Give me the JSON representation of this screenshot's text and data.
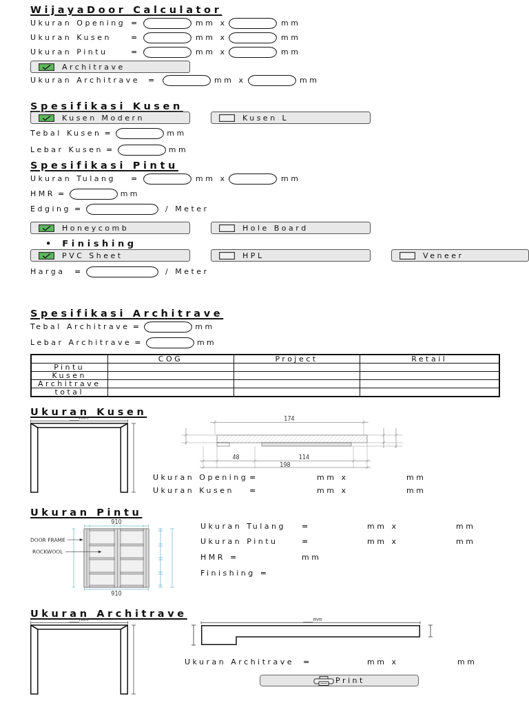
{
  "title": "WijayaDoor Calculator",
  "size_rows": [
    {
      "label": "Ukuran Opening",
      "sep": "=",
      "units": [
        "mm x",
        "mm"
      ]
    },
    {
      "label": "Ukuran Kusen",
      "sep": "=",
      "units": [
        "mm x",
        "mm"
      ]
    },
    {
      "label": "Ukuran Pintu",
      "sep": "=",
      "units": [
        "mm x",
        "mm"
      ]
    }
  ],
  "architrave_toggle": {
    "label": "Architrave",
    "checked": true
  },
  "architrave_row": {
    "label": "Ukuran Architrave",
    "sep": "=",
    "units": [
      "mm x",
      "mm"
    ]
  },
  "kusen_spec": {
    "heading": "Spesifikasi Kusen",
    "options": [
      {
        "label": "Kusen Modern",
        "checked": true
      },
      {
        "label": "Kusen L",
        "checked": false
      }
    ],
    "rows": [
      {
        "label": "Tebal Kusen",
        "sep": "=",
        "units": [
          "mm"
        ]
      },
      {
        "label": "Lebar Kusen",
        "sep": "=",
        "units": [
          "mm"
        ]
      }
    ]
  },
  "pintu_spec": {
    "heading": "Spesifikasi Pintu",
    "rows": [
      {
        "kind": "dimension",
        "label": "Ukuran Tulang",
        "sep": "=",
        "units": [
          "mm x",
          "mm"
        ]
      },
      {
        "kind": "single",
        "label": "HMR",
        "sep": "=",
        "units": [
          "mm"
        ]
      },
      {
        "kind": "rate",
        "label": "Edging",
        "sep": "=",
        "units": [
          "/ Meter"
        ]
      }
    ],
    "core_options": [
      {
        "label": "Honeycomb",
        "checked": true
      },
      {
        "label": "Hole Board",
        "checked": false
      }
    ],
    "finishing": {
      "bullet": "•",
      "heading": "Finishing",
      "options": [
        {
          "label": "PVC Sheet",
          "checked": true
        },
        {
          "label": "HPL",
          "checked": false
        },
        {
          "label": "Veneer",
          "checked": false
        }
      ]
    },
    "price_row": {
      "label": "Harga",
      "sep": "=",
      "units": [
        "/ Meter"
      ]
    }
  },
  "architrave_spec": {
    "heading": "Spesifikasi Architrave",
    "rows": [
      {
        "label": "Tebal Architrave",
        "sep": "=",
        "units": [
          "mm"
        ]
      },
      {
        "label": "Lebar Architrave",
        "sep": "=",
        "units": [
          "mm"
        ]
      }
    ]
  },
  "price_table": {
    "columns": [
      "COG",
      "Project",
      "Retail"
    ],
    "rows": [
      "Pintu",
      "Kusen",
      "Architrave",
      "total"
    ]
  },
  "kusen_section": {
    "heading": "Ukuran Kusen",
    "frame_width_label": "____mm",
    "profile_dimensions": [
      "174",
      "48",
      "114",
      "198"
    ],
    "rows": [
      {
        "label": "Ukuran Opening",
        "sep": "=",
        "units": [
          "mm x",
          "mm"
        ]
      },
      {
        "label": "Ukuran Kusen",
        "sep": "=",
        "units": [
          "mm x",
          "mm"
        ]
      }
    ]
  },
  "pintu_section": {
    "heading": "Ukuran Pintu",
    "door_width_labels": [
      "910",
      "910"
    ],
    "callouts": [
      "DOOR FRAME",
      "ROCKWOOL"
    ],
    "rows": [
      {
        "label": "Ukuran Tulang",
        "sep": "=",
        "units": [
          "mm x",
          "mm"
        ]
      },
      {
        "label": "Ukuran Pintu",
        "sep": "=",
        "units": [
          "mm x",
          "mm"
        ]
      },
      {
        "label": "HMR =",
        "units": [
          "mm"
        ]
      },
      {
        "label": "Finishing ="
      }
    ]
  },
  "architrave_section": {
    "heading": "Ukuran Architrave",
    "frame_width_label": "____mm",
    "profile_width_label": "____mm",
    "rows": [
      {
        "label": "Ukuran Architrave",
        "sep": "=",
        "units": [
          "mm x",
          "mm"
        ]
      }
    ],
    "print_button": {
      "label": "Print"
    }
  }
}
